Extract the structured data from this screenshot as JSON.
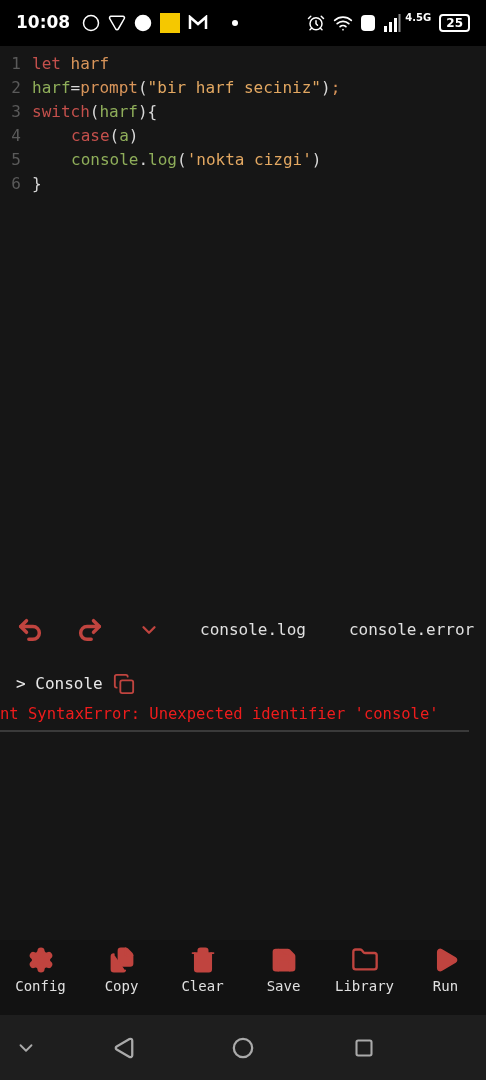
{
  "status_bar": {
    "time": "10:08",
    "network": "4.5G",
    "battery": "25"
  },
  "editor": {
    "lines": [
      {
        "number": "1",
        "tokens": [
          {
            "kind": "keyword",
            "text": "let "
          },
          {
            "kind": "name",
            "text": "harf"
          }
        ]
      },
      {
        "number": "2",
        "tokens": [
          {
            "kind": "variable",
            "text": "harf"
          },
          {
            "kind": "punct",
            "text": "="
          },
          {
            "kind": "name",
            "text": "prompt"
          },
          {
            "kind": "punct",
            "text": "("
          },
          {
            "kind": "string",
            "text": "\"bir harf seciniz\""
          },
          {
            "kind": "punct",
            "text": ")"
          },
          {
            "kind": "name",
            "text": ";"
          }
        ]
      },
      {
        "number": "3",
        "tokens": [
          {
            "kind": "keyword",
            "text": "switch"
          },
          {
            "kind": "punct",
            "text": "("
          },
          {
            "kind": "variable",
            "text": "harf"
          },
          {
            "kind": "punct",
            "text": "){"
          }
        ]
      },
      {
        "number": "4",
        "indented": true,
        "tokens": [
          {
            "kind": "keyword",
            "text": "case"
          },
          {
            "kind": "punct",
            "text": "("
          },
          {
            "kind": "variable",
            "text": "a"
          },
          {
            "kind": "punct",
            "text": ")"
          }
        ]
      },
      {
        "number": "5",
        "indented": true,
        "tokens": [
          {
            "kind": "variable",
            "text": "console"
          },
          {
            "kind": "punct",
            "text": "."
          },
          {
            "kind": "variable",
            "text": "log"
          },
          {
            "kind": "punct",
            "text": "("
          },
          {
            "kind": "string",
            "text": "'nokta cizgi'"
          },
          {
            "kind": "punct",
            "text": ")"
          }
        ]
      },
      {
        "number": "6",
        "tokens": [
          {
            "kind": "punct",
            "text": "}"
          }
        ]
      }
    ]
  },
  "quick_bar": {
    "snippets": [
      "console.log",
      "console.error"
    ]
  },
  "console": {
    "title": "> Console",
    "error": "nt SyntaxError: Unexpected identifier 'console'"
  },
  "toolbar": [
    {
      "kind": "config",
      "label": "Config"
    },
    {
      "kind": "copy",
      "label": "Copy"
    },
    {
      "kind": "clear",
      "label": "Clear"
    },
    {
      "kind": "save",
      "label": "Save"
    },
    {
      "kind": "library",
      "label": "Library"
    },
    {
      "kind": "run",
      "label": "Run"
    }
  ]
}
